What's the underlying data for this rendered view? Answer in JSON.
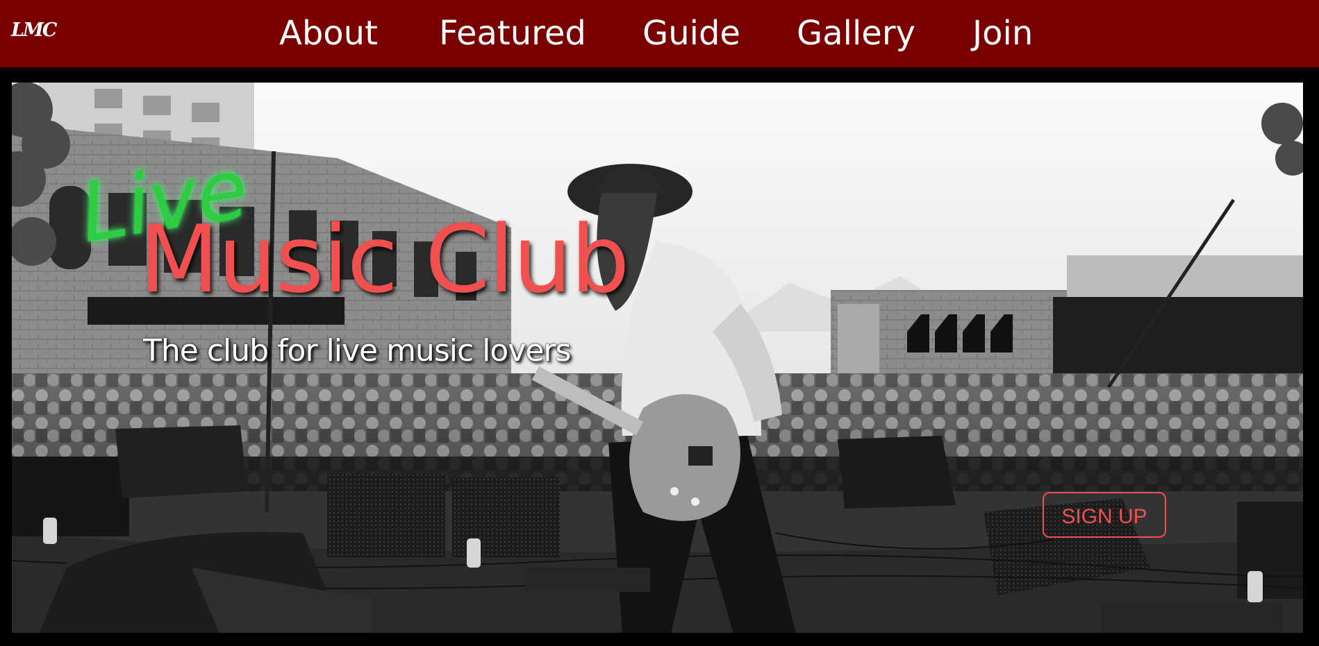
{
  "nav": {
    "logo": "LMC",
    "links": [
      "About",
      "Featured",
      "Guide",
      "Gallery",
      "Join"
    ],
    "background": "#7a0000"
  },
  "hero": {
    "title_accent": "Live",
    "title_main": "Music Club",
    "tagline": "The club for live music lovers",
    "signup_label": "SIGN UP",
    "image_description": "black-and-white concert photo of a guitarist on an outdoor street stage in front of a large crowd",
    "colors": {
      "accent_green": "#2ecc40",
      "accent_red": "#f05050"
    }
  }
}
